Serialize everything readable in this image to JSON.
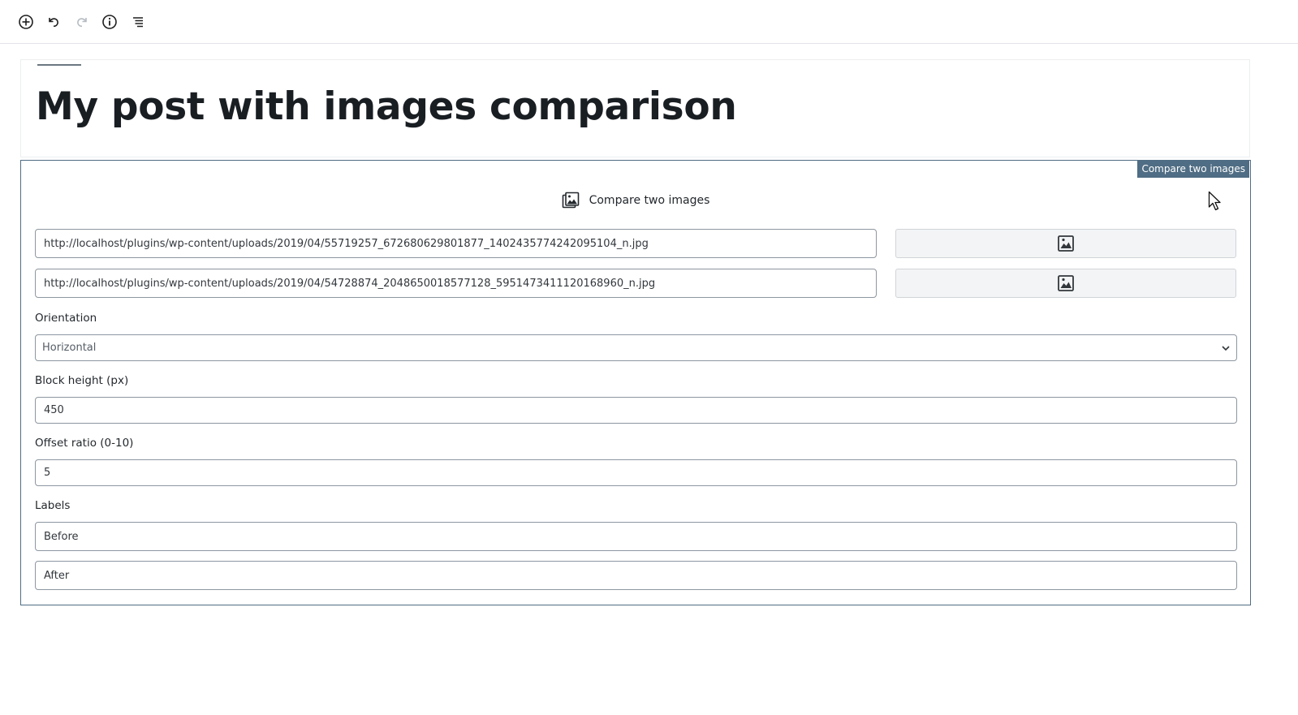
{
  "toolbar": {
    "add_icon": "plus-circle-icon",
    "undo_icon": "undo-icon",
    "redo_icon": "redo-icon",
    "info_icon": "info-icon",
    "outline_icon": "list-outline-icon"
  },
  "post": {
    "title": "My post with images comparison"
  },
  "compare_block": {
    "tag_label": "Compare two images",
    "header_label": "Compare two images",
    "header_icon": "images-icon",
    "image_urls": [
      "http://localhost/plugins/wp-content/uploads/2019/04/55719257_672680629801877_1402435774242095104_n.jpg",
      "http://localhost/plugins/wp-content/uploads/2019/04/54728874_2048650018577128_5951473411120168960_n.jpg"
    ],
    "media_button_icon": "image-icon",
    "orientation": {
      "label": "Orientation",
      "selected": "Horizontal"
    },
    "block_height": {
      "label": "Block height (px)",
      "value": "450"
    },
    "offset_ratio": {
      "label": "Offset ratio (0-10)",
      "value": "5"
    },
    "labels": {
      "label": "Labels",
      "before": "Before",
      "after": "After"
    }
  },
  "colors": {
    "accent": "#4f6d84",
    "title": "#191e23",
    "border": "#8d96a0"
  }
}
